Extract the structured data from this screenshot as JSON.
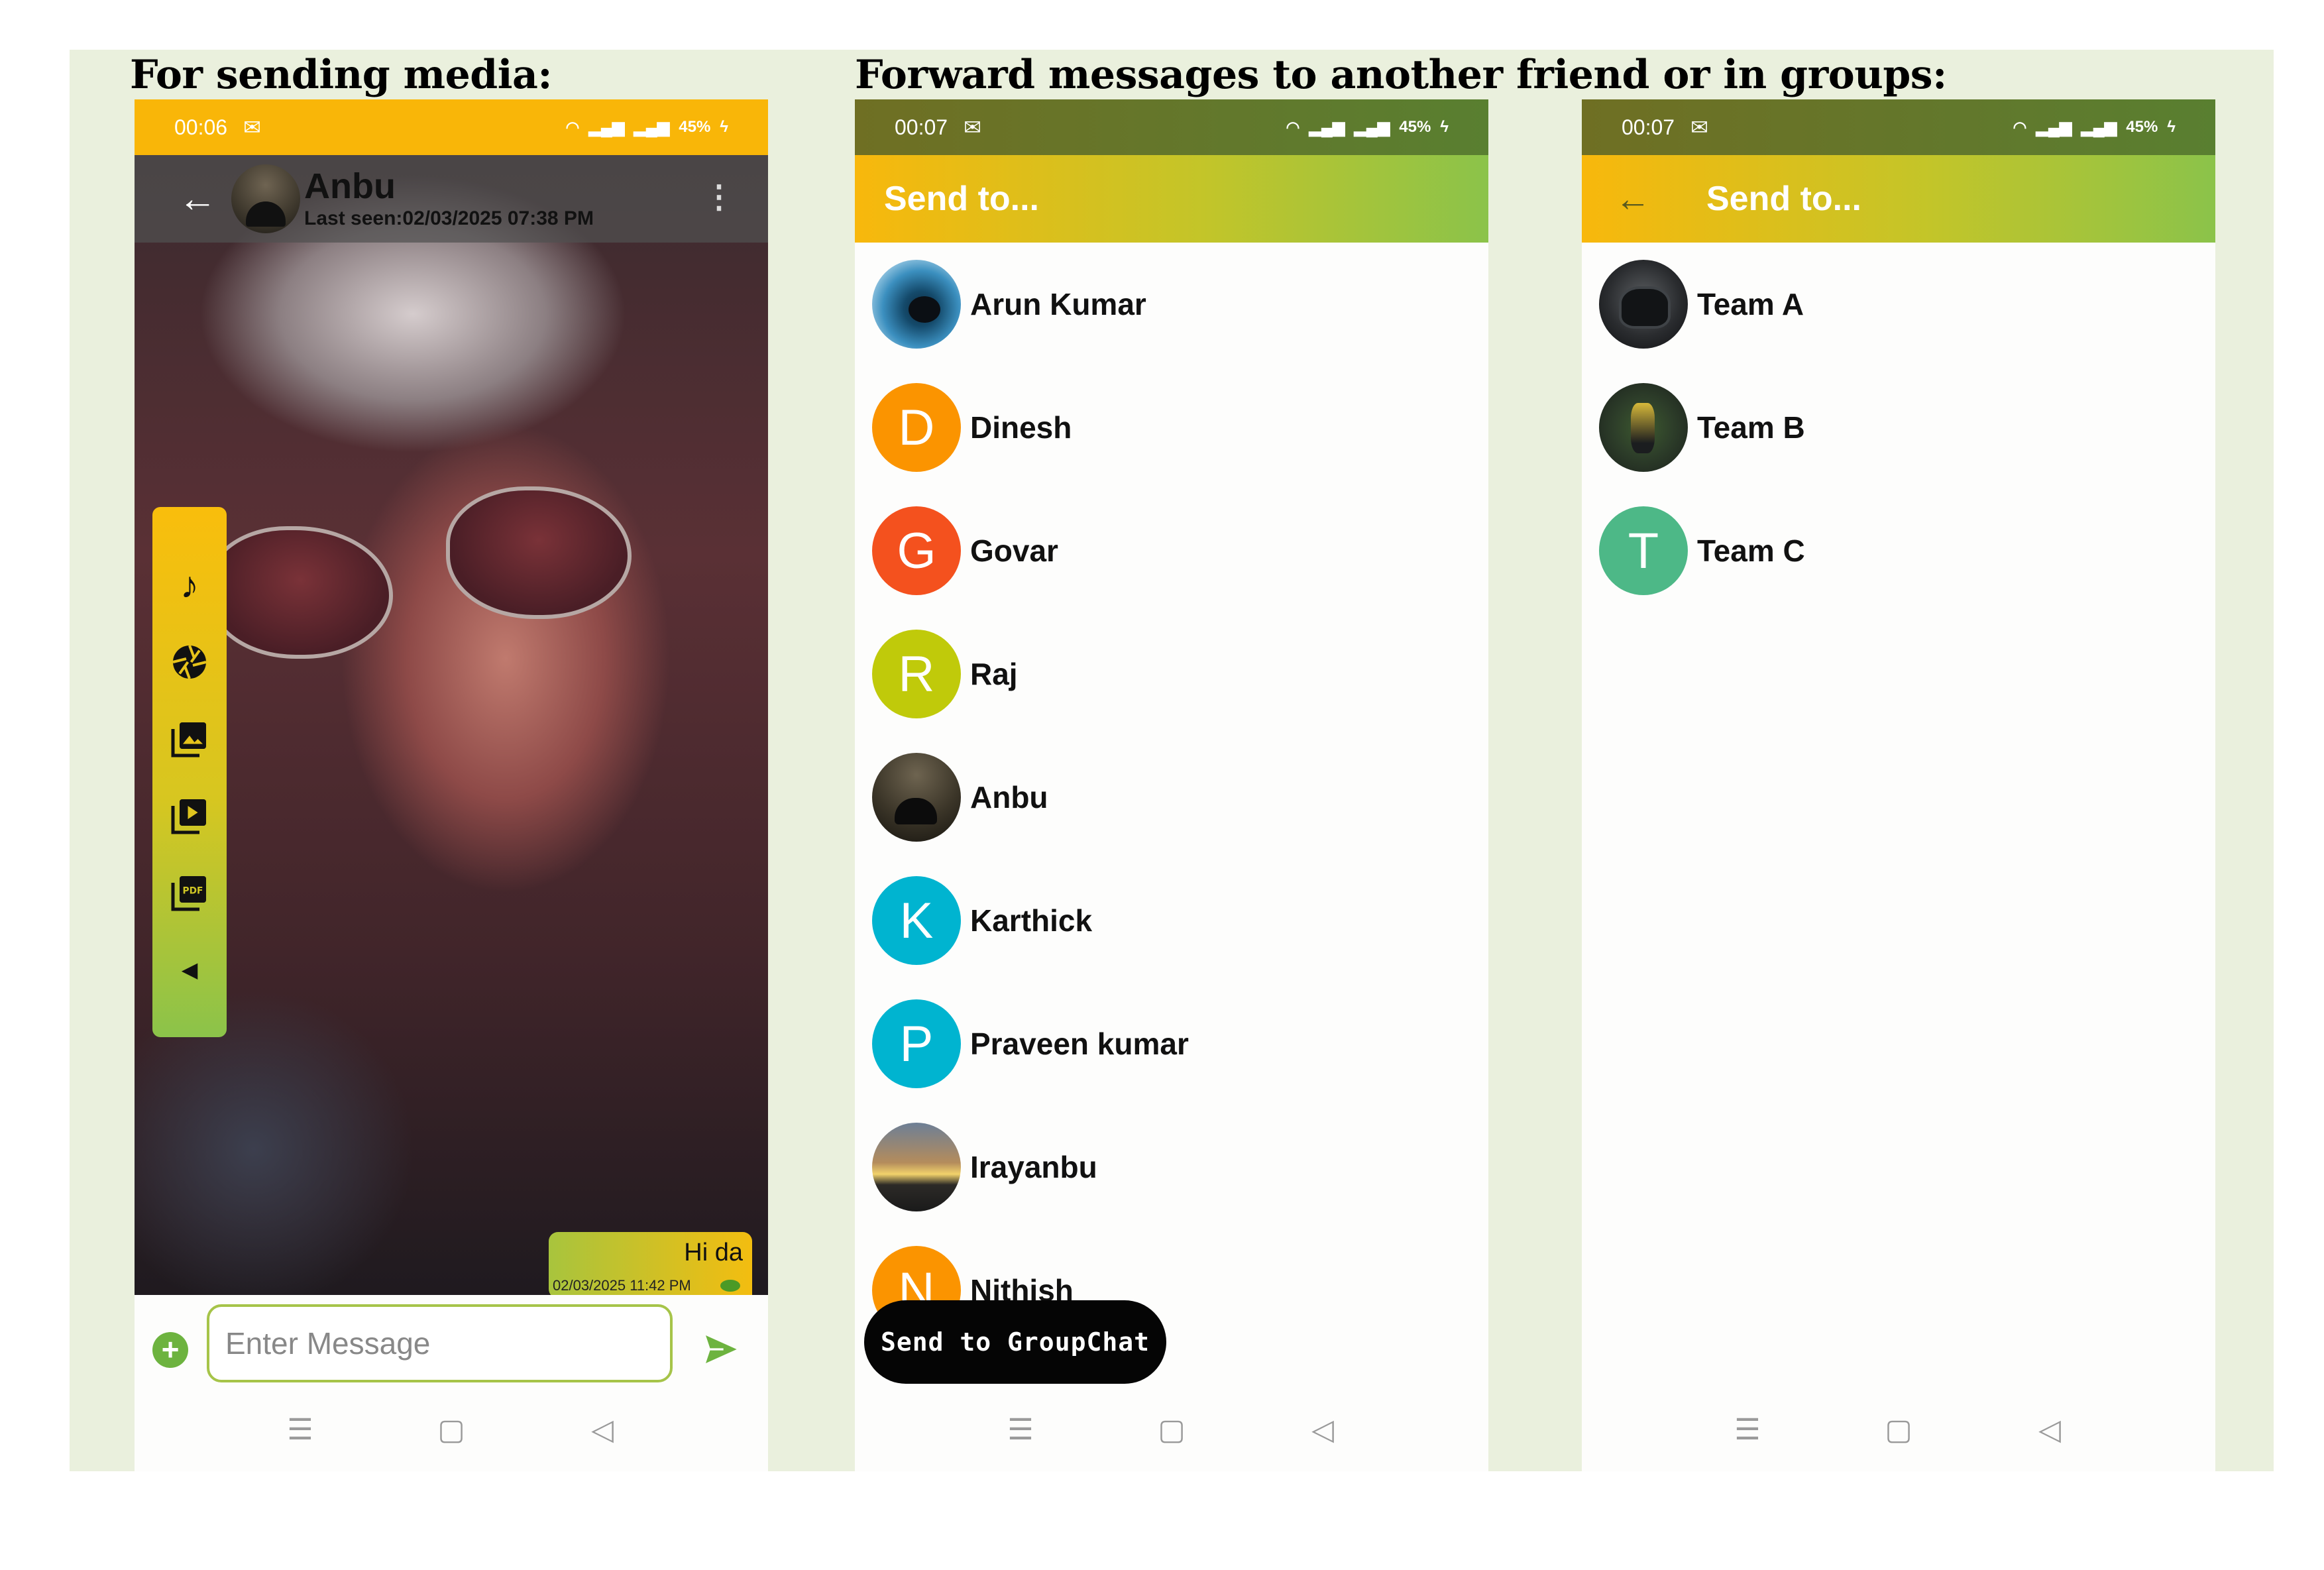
{
  "headings": {
    "left": "For sending media:",
    "right": "Forward messages to another friend or in groups:"
  },
  "status_indicators": {
    "battery": "45%",
    "mail_icon": "mail-icon",
    "wifi_icon": "wifi-icon",
    "signal_icon": "signal-icon",
    "charging_icon": "charging-icon"
  },
  "chat_screen": {
    "time": "00:06",
    "contact_name": "Anbu",
    "last_seen": "Last seen:02/03/2025 07:38 PM",
    "media_buttons": [
      "music-icon",
      "camera-shutter-icon",
      "gallery-icon",
      "video-library-icon",
      "pdf-icon",
      "collapse-left-icon"
    ],
    "message": {
      "text": "Hi da",
      "timestamp": "02/03/2025 11:42 PM"
    },
    "input_placeholder": "Enter Message"
  },
  "forward_friends": {
    "time": "00:07",
    "title": "Send to...",
    "contacts": [
      {
        "name": "Arun Kumar",
        "initial": "",
        "color": "#3b8fbf"
      },
      {
        "name": "Dinesh",
        "initial": "D",
        "color": "#fb9400"
      },
      {
        "name": "Govar",
        "initial": "G",
        "color": "#f4511e"
      },
      {
        "name": "Raj",
        "initial": "R",
        "color": "#c0ca0a"
      },
      {
        "name": "Anbu",
        "initial": "",
        "color": "#3b3528"
      },
      {
        "name": "Karthick",
        "initial": "K",
        "color": "#00b4d0"
      },
      {
        "name": "Praveen kumar",
        "initial": "P",
        "color": "#00b4d0"
      },
      {
        "name": "Irayanbu",
        "initial": "",
        "color": "#b48c5c"
      },
      {
        "name": "Nithish",
        "initial": "N",
        "color": "#fb9400"
      }
    ],
    "group_button": "Send to GroupChat"
  },
  "forward_groups": {
    "time": "00:07",
    "title": "Send to...",
    "groups": [
      {
        "name": "Team A",
        "initial": "",
        "color": "#2a2c2f"
      },
      {
        "name": "Team B",
        "initial": "",
        "color": "#2e3f2a"
      },
      {
        "name": "Team C",
        "initial": "T",
        "color": "#4db887"
      }
    ]
  }
}
